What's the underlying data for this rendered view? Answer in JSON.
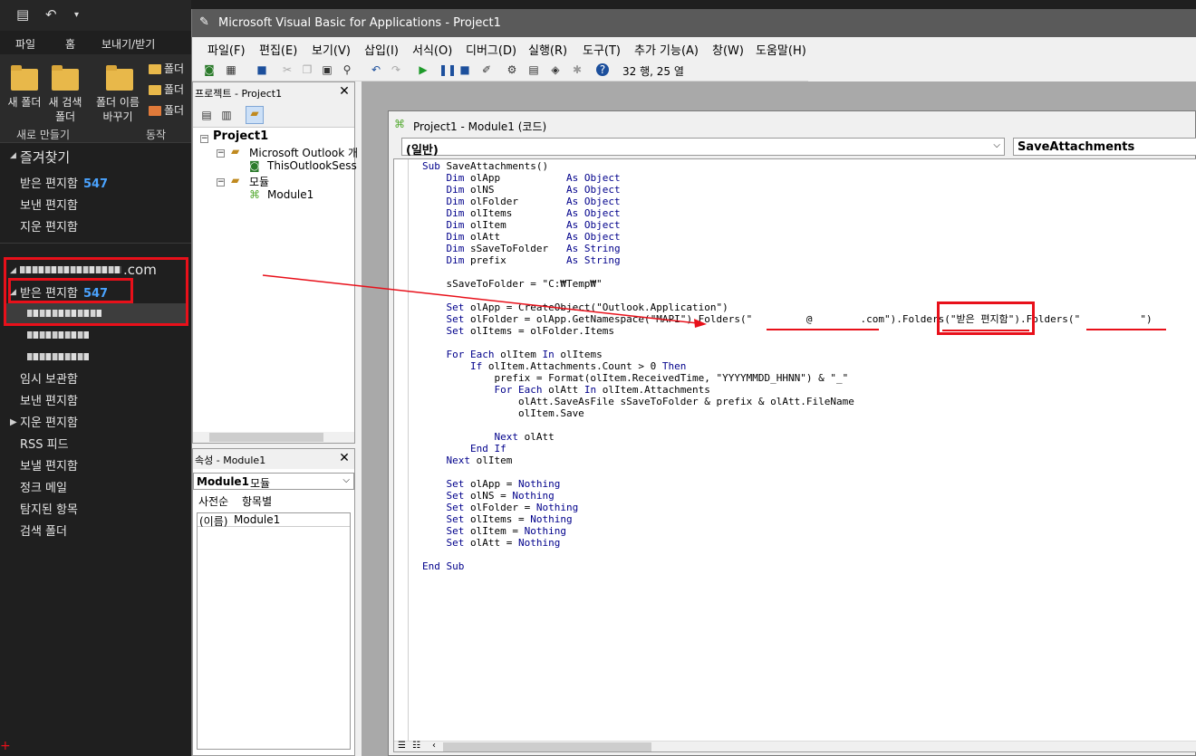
{
  "outlook": {
    "ribbon_tabs": [
      "파일",
      "홈",
      "보내기/받기"
    ],
    "ribbon": {
      "new_folder": "새 폴더",
      "new_search_folder": [
        "새 검색",
        "폴더"
      ],
      "rename_folder": [
        "폴더 이름",
        "바꾸기"
      ],
      "small_items": [
        "폴더",
        "폴더",
        "폴더"
      ],
      "group_new": "새로 만들기",
      "group_actions": "동작"
    },
    "favorites": {
      "header": "즐겨찾기",
      "items": [
        {
          "label": "받은 편지함",
          "count": "547"
        },
        {
          "label": "보낸 편지함"
        },
        {
          "label": "지운 편지함"
        }
      ]
    },
    "account": {
      "name_suffix": ".com",
      "inbox": {
        "label": "받은 편지함",
        "count": "547"
      },
      "folders": [
        "임시 보관함",
        "보낸 편지함",
        "지운 편지함",
        "RSS 피드",
        "보낼 편지함",
        "정크 메일",
        "탐지된 항목",
        "검색 폴더"
      ]
    }
  },
  "vba": {
    "title": "Microsoft Visual Basic for Applications - Project1",
    "menu": [
      "파일(F)",
      "편집(E)",
      "보기(V)",
      "삽입(I)",
      "서식(O)",
      "디버그(D)",
      "실행(R)",
      "도구(T)",
      "추가 기능(A)",
      "창(W)",
      "도움말(H)"
    ],
    "cursor_position": "32 행, 25 열",
    "project_pane": {
      "title": "프로젝트 - Project1",
      "root": "Project1",
      "outlook_objects": "Microsoft Outlook 개",
      "session": "ThisOutlookSess",
      "modules_folder": "모듈",
      "module": "Module1"
    },
    "props_pane": {
      "title": "속성 - Module1",
      "object": "Module1",
      "object_type": "모듈",
      "tabs": [
        "사전순",
        "항목별"
      ],
      "name_key": "(이름)",
      "name_value": "Module1"
    },
    "code_window": {
      "title": "Project1 - Module1 (코드)",
      "object_combo": "(일반)",
      "proc_combo": "SaveAttachments",
      "lines": [
        "Sub SaveAttachments()",
        "    Dim olApp           As Object",
        "    Dim olNS            As Object",
        "    Dim olFolder        As Object",
        "    Dim olItems         As Object",
        "    Dim olItem          As Object",
        "    Dim olAtt           As Object",
        "    Dim sSaveToFolder   As String",
        "    Dim prefix          As String",
        "",
        "    sSaveToFolder = \"C:₩Temp₩\"",
        "",
        "    Set olApp = CreateObject(\"Outlook.Application\")",
        "    Set olFolder = olApp.GetNamespace(\"MAPI\").Folders(\"         @        .com\").Folders(\"받은 편지함\").Folders(\"          \")",
        "    Set olItems = olFolder.Items",
        "",
        "    For Each olItem In olItems",
        "        If olItem.Attachments.Count > 0 Then",
        "            prefix = Format(olItem.ReceivedTime, \"YYYYMMDD_HHNN\") & \"_\"",
        "            For Each olAtt In olItem.Attachments",
        "                olAtt.SaveAsFile sSaveToFolder & prefix & olAtt.FileName",
        "                olItem.Save",
        "",
        "            Next olAtt",
        "        End If",
        "    Next olItem",
        "",
        "    Set olApp = Nothing",
        "    Set olNS = Nothing",
        "    Set olFolder = Nothing",
        "    Set olItems = Nothing",
        "    Set olItem = Nothing",
        "    Set olAtt = Nothing",
        "",
        "End Sub"
      ]
    }
  },
  "colors": {
    "highlight_red": "#e8101a",
    "count_blue": "#4aa3ff"
  }
}
